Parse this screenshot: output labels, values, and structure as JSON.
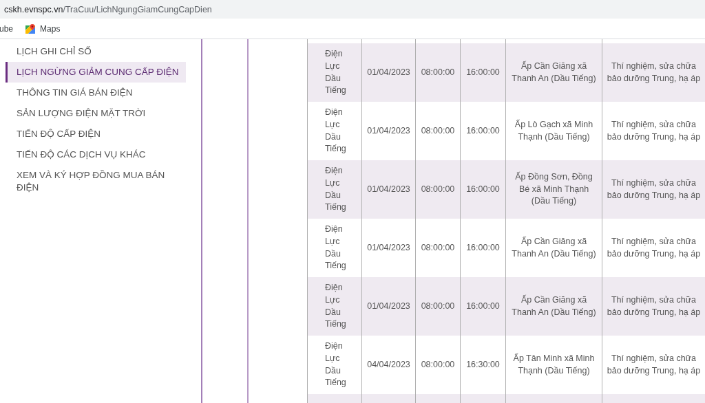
{
  "browser": {
    "address": {
      "host": "cskh.evnspc.vn",
      "path": "/TraCuu/LichNgungGiamCungCapDien"
    },
    "bookmarks": [
      {
        "label": "ube",
        "kind": "text"
      },
      {
        "label": "Maps",
        "kind": "favicon"
      }
    ]
  },
  "sidebar": {
    "items": [
      {
        "label": "LỊCH GHI CHỈ SỐ",
        "selected": false
      },
      {
        "label": "LỊCH NGỪNG GIẢM CUNG CẤP ĐIỆN",
        "selected": true
      },
      {
        "label": "THÔNG TIN GIÁ BÁN ĐIỆN",
        "selected": false
      },
      {
        "label": "SẢN LƯỢNG ĐIỆN MẶT TRỜI",
        "selected": false
      },
      {
        "label": "TIẾN ĐỘ CẤP ĐIỆN",
        "selected": false
      },
      {
        "label": "TIẾN ĐỘ CÁC DỊCH VỤ KHÁC",
        "selected": false
      },
      {
        "label": "XEM VÀ KÝ HỢP ĐỒNG MUA BÁN ĐIỆN",
        "selected": false
      }
    ]
  },
  "table": {
    "rows": [
      {
        "cells": [
          "Điện Lực Dầu Tiếng",
          "01/04/2023",
          "08:00:00",
          "16:00:00",
          "Ấp Cần Giăng xã Thanh An (Dầu Tiếng)",
          "Thí nghiệm, sửa chữa bảo dưỡng Trung, hạ áp"
        ]
      },
      {
        "cells": [
          "Điện Lực Dầu Tiếng",
          "01/04/2023",
          "08:00:00",
          "16:00:00",
          "Ấp Lò Gạch xã Minh Thạnh (Dầu Tiếng)",
          "Thí nghiệm, sửa chữa bảo dưỡng Trung, hạ áp"
        ]
      },
      {
        "cells": [
          "Điện Lực Dầu Tiếng",
          "01/04/2023",
          "08:00:00",
          "16:00:00",
          "Ấp Đồng Sơn, Đồng Bé xã Minh Thạnh (Dầu Tiếng)",
          "Thí nghiệm, sửa chữa bảo dưỡng Trung, hạ áp"
        ]
      },
      {
        "cells": [
          "Điện Lực Dầu Tiếng",
          "01/04/2023",
          "08:00:00",
          "16:00:00",
          "Ấp Cần Giăng xã Thanh An (Dầu Tiếng)",
          "Thí nghiệm, sửa chữa bảo dưỡng Trung, hạ áp"
        ]
      },
      {
        "cells": [
          "Điện Lực Dầu Tiếng",
          "01/04/2023",
          "08:00:00",
          "16:00:00",
          "Ấp Cần Giăng xã Thanh An (Dầu Tiếng)",
          "Thí nghiệm, sửa chữa bảo dưỡng Trung, hạ áp"
        ]
      },
      {
        "cells": [
          "Điện Lực Dầu Tiếng",
          "04/04/2023",
          "08:00:00",
          "16:30:00",
          "Ấp Tân Minh xã Minh Thạnh (Dầu Tiếng)",
          "Thí nghiệm, sửa chữa bảo dưỡng Trung, hạ áp"
        ]
      }
    ]
  }
}
